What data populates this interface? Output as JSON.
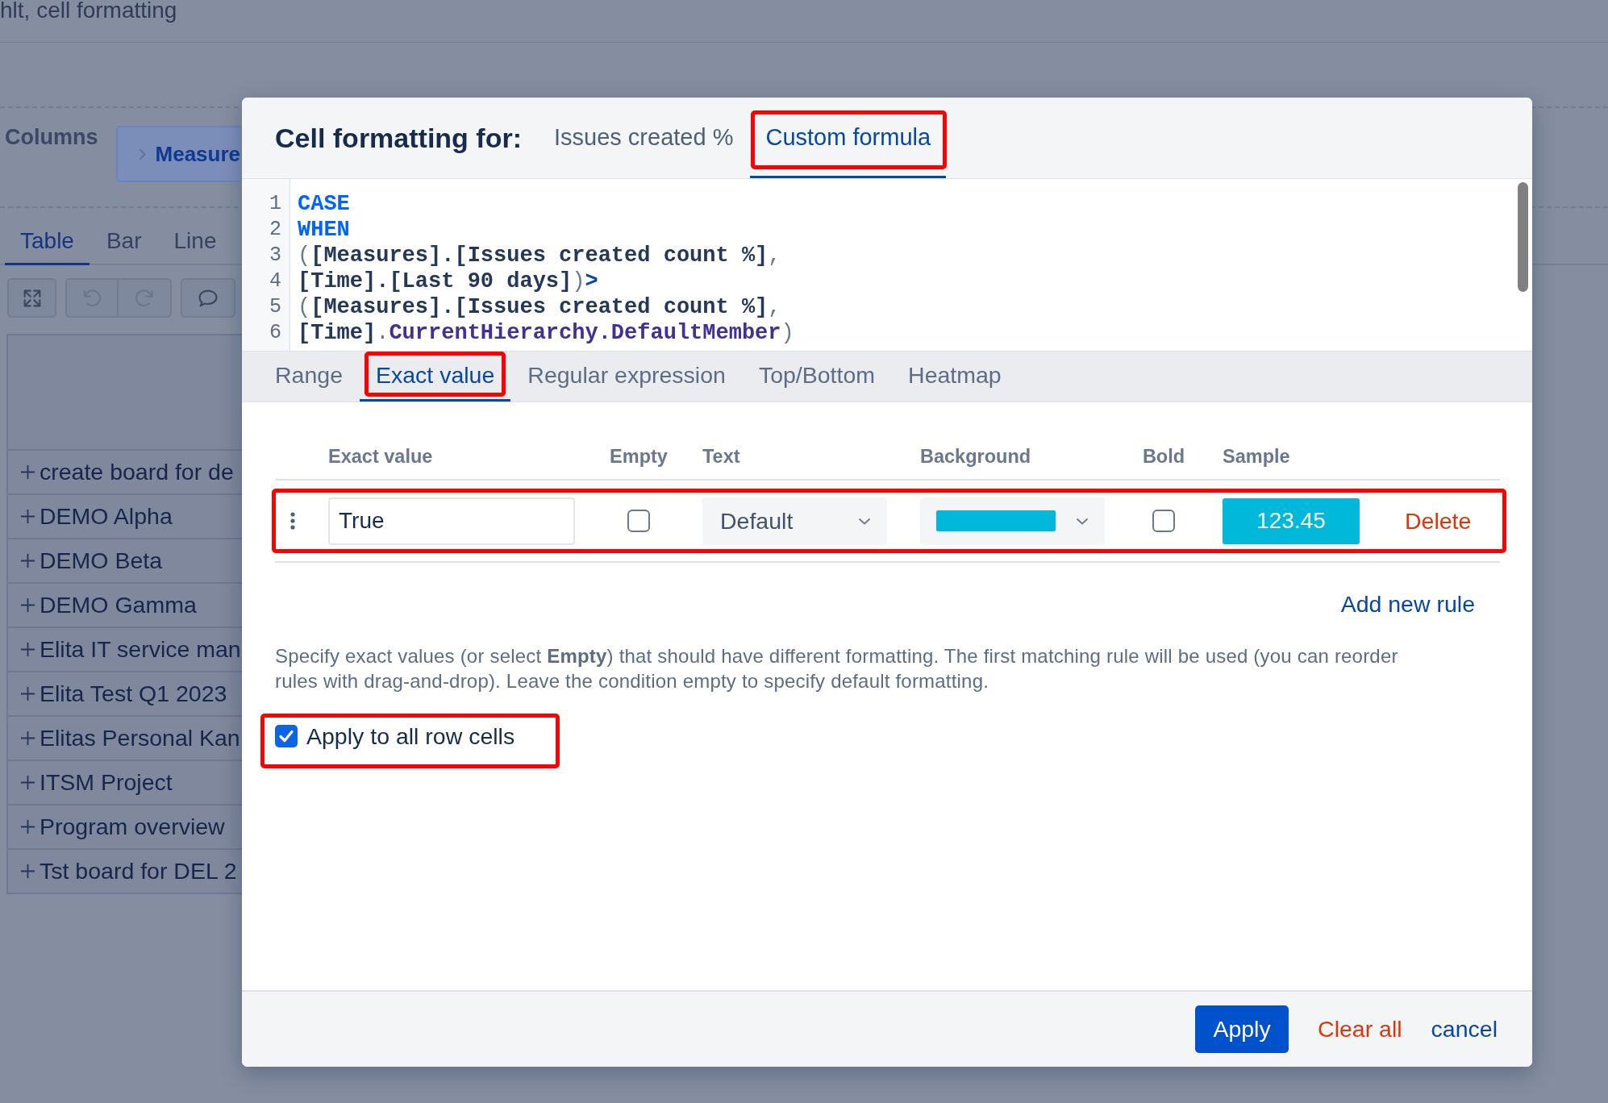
{
  "background_page": {
    "title": "hlt, cell formatting",
    "columns_label": "Columns",
    "measures_chip": "Measure",
    "view_tabs": [
      {
        "label": "Table",
        "selected": true
      },
      {
        "label": "Bar",
        "selected": false
      },
      {
        "label": "Line",
        "selected": false
      }
    ],
    "toolbar_groups": [
      {
        "buttons": [
          {
            "kind": "expand",
            "disabled": false
          }
        ]
      },
      {
        "buttons": [
          {
            "kind": "undo",
            "disabled": true
          },
          {
            "kind": "redo",
            "disabled": true
          }
        ]
      },
      {
        "buttons": [
          {
            "kind": "comment",
            "disabled": false
          }
        ]
      }
    ],
    "table_rows": [
      "create board for de",
      "DEMO Alpha",
      "DEMO Beta",
      "DEMO Gamma",
      "Elita IT service man",
      "Elita Test Q1 2023",
      "Elitas Personal Kan",
      "ITSM Project",
      "Program overview",
      "Tst board for DEL 2"
    ]
  },
  "dialog": {
    "title": "Cell formatting for:",
    "target_tabs": [
      {
        "label": "Issues created %",
        "selected": false,
        "highlighted": false
      },
      {
        "label": "Custom formula",
        "selected": true,
        "highlighted": true
      }
    ],
    "formula_lines": [
      {
        "number": "1",
        "tokens": [
          {
            "kind": "keyword",
            "text": "CASE"
          }
        ]
      },
      {
        "number": "2",
        "tokens": [
          {
            "kind": "keyword",
            "text": "WHEN"
          }
        ]
      },
      {
        "number": "3",
        "tokens": [
          {
            "kind": "punct",
            "text": "("
          },
          {
            "kind": "ident",
            "text": "[Measures].[Issues created count %]"
          },
          {
            "kind": "punct",
            "text": ","
          }
        ]
      },
      {
        "number": "4",
        "tokens": [
          {
            "kind": "ident",
            "text": "[Time].[Last 90 days]"
          },
          {
            "kind": "punct",
            "text": ")"
          },
          {
            "kind": "operator",
            "text": ">"
          }
        ]
      },
      {
        "number": "5",
        "tokens": [
          {
            "kind": "punct",
            "text": "("
          },
          {
            "kind": "ident",
            "text": "[Measures].[Issues created count %]"
          },
          {
            "kind": "punct",
            "text": ","
          }
        ]
      },
      {
        "number": "6",
        "tokens": [
          {
            "kind": "ident",
            "text": "[Time]"
          },
          {
            "kind": "punct",
            "text": "."
          },
          {
            "kind": "member",
            "text": "CurrentHierarchy.DefaultMember"
          },
          {
            "kind": "punct",
            "text": ")"
          }
        ]
      }
    ],
    "rule_tabs": [
      {
        "label": "Range",
        "selected": false,
        "highlighted": false
      },
      {
        "label": "Exact value",
        "selected": true,
        "highlighted": true
      },
      {
        "label": "Regular expression",
        "selected": false,
        "highlighted": false
      },
      {
        "label": "Top/Bottom",
        "selected": false,
        "highlighted": false
      },
      {
        "label": "Heatmap",
        "selected": false,
        "highlighted": false
      }
    ],
    "rules_table": {
      "columns": [
        "Exact value",
        "Empty",
        "Text",
        "Background",
        "Bold",
        "Sample"
      ],
      "rows": [
        {
          "highlighted": true,
          "value": "True",
          "empty": false,
          "text_option": "Default",
          "color": "#00b8d9",
          "bold": false,
          "sample": "123.45",
          "delete_label": "Delete"
        }
      ]
    },
    "add_rule_label": "Add new rule",
    "help_text": "Specify exact values (or select **Empty**) that should have different formatting. The first matching rule will be used (you can reorder rules with drag-and-drop). Leave the condition empty to specify default formatting.",
    "apply_to_all_row_cells": {
      "label": "Apply to all row cells",
      "checked": true,
      "highlighted": true
    },
    "buttons": [
      {
        "kind": "primary",
        "label": "Apply"
      },
      {
        "kind": "danger",
        "label": "Clear all"
      },
      {
        "kind": "link",
        "label": "cancel"
      }
    ]
  }
}
